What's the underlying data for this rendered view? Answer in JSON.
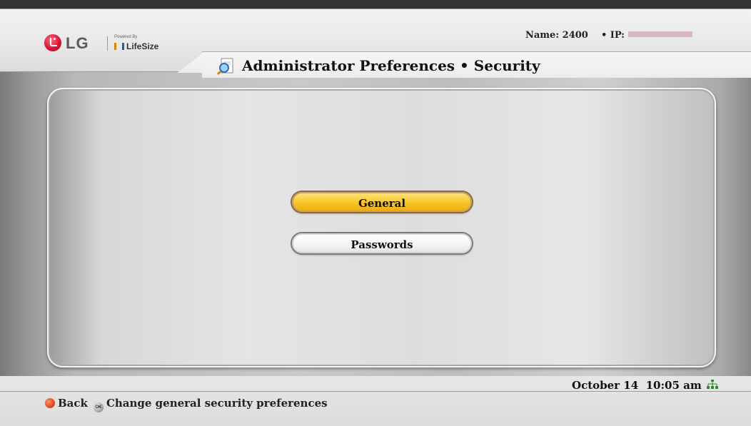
{
  "header": {
    "brand": "LG",
    "powered_by": "Powered By",
    "partner": "LifeSize",
    "name_label": "Name: 2400",
    "ip_label": "• IP:",
    "title": "Administrator Preferences • Security"
  },
  "menu": {
    "items": [
      {
        "label": "General",
        "selected": true
      },
      {
        "label": "Passwords",
        "selected": false
      }
    ]
  },
  "status": {
    "date": "October 14",
    "time": "10:05 am"
  },
  "hints": {
    "back_label": "Back",
    "ok_glyph": "OK",
    "action_label": "Change general security preferences"
  },
  "colors": {
    "selected_button": "#f8c82a",
    "unselected_button": "#ffffff",
    "back_button_red": "#e34b22",
    "lg_red": "#d9143a"
  },
  "icons": [
    "lg-logo-icon",
    "lifesize-logo-icon",
    "admin-preferences-icon",
    "network-status-icon",
    "back-button-icon",
    "ok-button-icon"
  ]
}
